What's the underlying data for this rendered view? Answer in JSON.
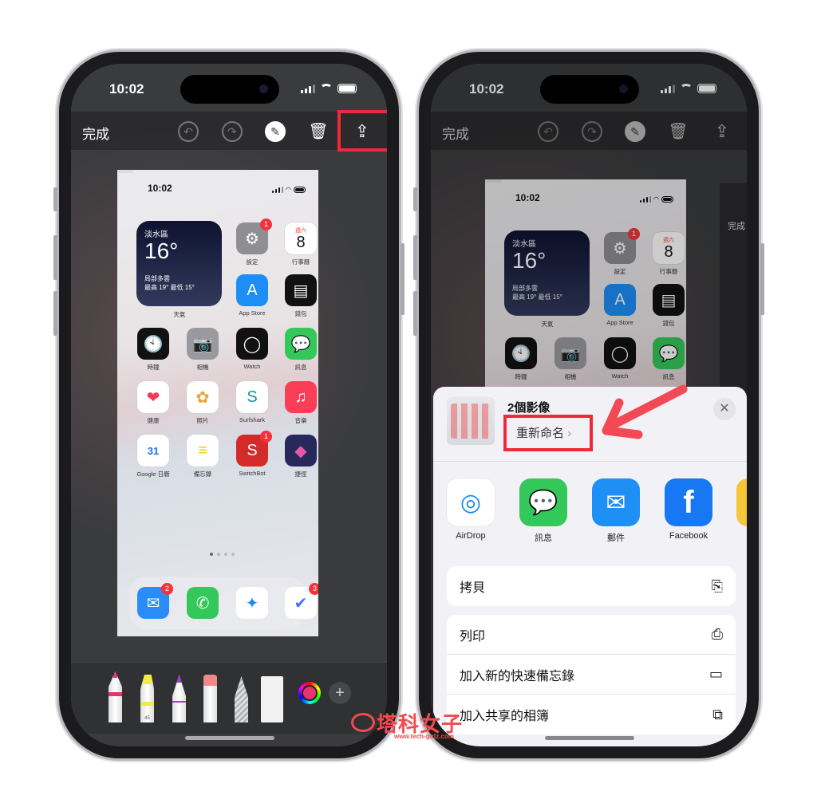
{
  "status": {
    "time": "10:02"
  },
  "toolbar": {
    "done": "完成",
    "icons": [
      "undo-icon",
      "redo-icon",
      "markup-pen-icon",
      "trash-icon",
      "share-icon"
    ]
  },
  "homescreen": {
    "time": "10:02",
    "weather": {
      "city": "淡水區",
      "temp": "16°",
      "condition": "局部多雲",
      "range": "最高 19° 最低 15°",
      "label": "天氣"
    },
    "apps": [
      {
        "name": "設定",
        "icon": "settings-icon",
        "bg": "#8e8e93",
        "glyph": "⚙",
        "badge": "1",
        "col": 2,
        "row": 0
      },
      {
        "name": "行事曆",
        "icon": "calendar-icon",
        "bg": "#ffffff",
        "day": "週六",
        "date": "8",
        "col": 3,
        "row": 0
      },
      {
        "name": "App Store",
        "icon": "app-store-icon",
        "bg": "#1d8ef5",
        "glyph": "A",
        "col": 2,
        "row": 1
      },
      {
        "name": "錢包",
        "icon": "wallet-icon",
        "bg": "#111111",
        "glyph": "▤",
        "col": 3,
        "row": 1
      },
      {
        "name": "時鐘",
        "icon": "clock-icon",
        "bg": "#111111",
        "glyph": "🕙",
        "col": 0,
        "row": 2
      },
      {
        "name": "相機",
        "icon": "camera-icon",
        "bg": "#9a9a9e",
        "glyph": "📷",
        "col": 1,
        "row": 2
      },
      {
        "name": "Watch",
        "icon": "watch-icon",
        "bg": "#111111",
        "glyph": "◯",
        "col": 2,
        "row": 2
      },
      {
        "name": "訊息",
        "icon": "messages-icon",
        "bg": "#34c759",
        "glyph": "💬",
        "col": 3,
        "row": 2
      },
      {
        "name": "健康",
        "icon": "health-icon",
        "bg": "#ffffff",
        "glyph": "❤",
        "fg": "#f5385a",
        "col": 0,
        "row": 3
      },
      {
        "name": "照片",
        "icon": "photos-icon",
        "bg": "#ffffff",
        "glyph": "✿",
        "fg": "#e9a23b",
        "col": 1,
        "row": 3
      },
      {
        "name": "Surfshark",
        "icon": "surfshark-icon",
        "bg": "#ffffff",
        "glyph": "S",
        "fg": "#1b8fa0",
        "col": 2,
        "row": 3
      },
      {
        "name": "音樂",
        "icon": "music-icon",
        "bg": "#fa3e57",
        "glyph": "♫",
        "col": 3,
        "row": 3
      },
      {
        "name": "Google 日曆",
        "icon": "google-calendar-icon",
        "bg": "#ffffff",
        "glyph": "31",
        "fg": "#1a73e8",
        "col": 0,
        "row": 4
      },
      {
        "name": "備忘錄",
        "icon": "notes-icon",
        "bg": "#ffffff",
        "glyph": "≡",
        "fg": "#f5c400",
        "col": 1,
        "row": 4
      },
      {
        "name": "SwitchBot",
        "icon": "switchbot-icon",
        "bg": "#d32a2a",
        "glyph": "S",
        "badge": "1",
        "col": 2,
        "row": 4
      },
      {
        "name": "捷徑",
        "icon": "shortcuts-icon",
        "bg": "#27295a",
        "glyph": "◆",
        "fg": "#e05ba5",
        "col": 3,
        "row": 4
      }
    ],
    "dock": [
      {
        "icon": "mail-icon",
        "bg": "#2a8cf7",
        "glyph": "✉",
        "badge": "2"
      },
      {
        "icon": "phone-icon",
        "bg": "#34c759",
        "glyph": "✆"
      },
      {
        "icon": "safari-icon",
        "bg": "#ffffff",
        "glyph": "✦",
        "fg": "#1a8af5"
      },
      {
        "icon": "ticktick-icon",
        "bg": "#ffffff",
        "glyph": "✔",
        "fg": "#4a72f5",
        "badge": "3"
      }
    ]
  },
  "markup_tools": {
    "highlighter_number": "45",
    "tools": [
      "pen-tool",
      "highlighter-tool",
      "pencil-tool",
      "eraser-tool",
      "lasso-tool",
      "ruler-tool"
    ],
    "color": "#e8336f"
  },
  "share_sheet": {
    "title": "2個影像",
    "rename": "重新命名",
    "chevron": "›",
    "close": "✕",
    "apps": [
      {
        "label": "AirDrop",
        "icon": "airdrop-icon",
        "bg": "#ffffff",
        "glyph": "◎",
        "fg": "#1a8af5"
      },
      {
        "label": "訊息",
        "icon": "messages-icon",
        "bg": "#34c759",
        "glyph": "💬"
      },
      {
        "label": "郵件",
        "icon": "mail-icon",
        "bg": "#1e90f5",
        "glyph": "✉"
      },
      {
        "label": "Facebook",
        "icon": "facebook-icon",
        "bg": "#1877f2",
        "glyph": "f"
      }
    ],
    "actions": [
      {
        "label": "拷貝",
        "icon": "copy-icon",
        "glyph": "⎘"
      },
      {
        "label": "列印",
        "icon": "printer-icon",
        "glyph": "⎙"
      },
      {
        "label": "加入新的快速備忘錄",
        "icon": "quick-note-icon",
        "glyph": "▭"
      },
      {
        "label": "加入共享的相簿",
        "icon": "shared-album-icon",
        "glyph": "⧉"
      }
    ],
    "behind_done": "完成"
  },
  "watermark": {
    "brand": "塔科女子",
    "url": "www.tech-girlz.com"
  },
  "colors": {
    "highlight": "#f0283c",
    "accent": "#1a8af5"
  }
}
